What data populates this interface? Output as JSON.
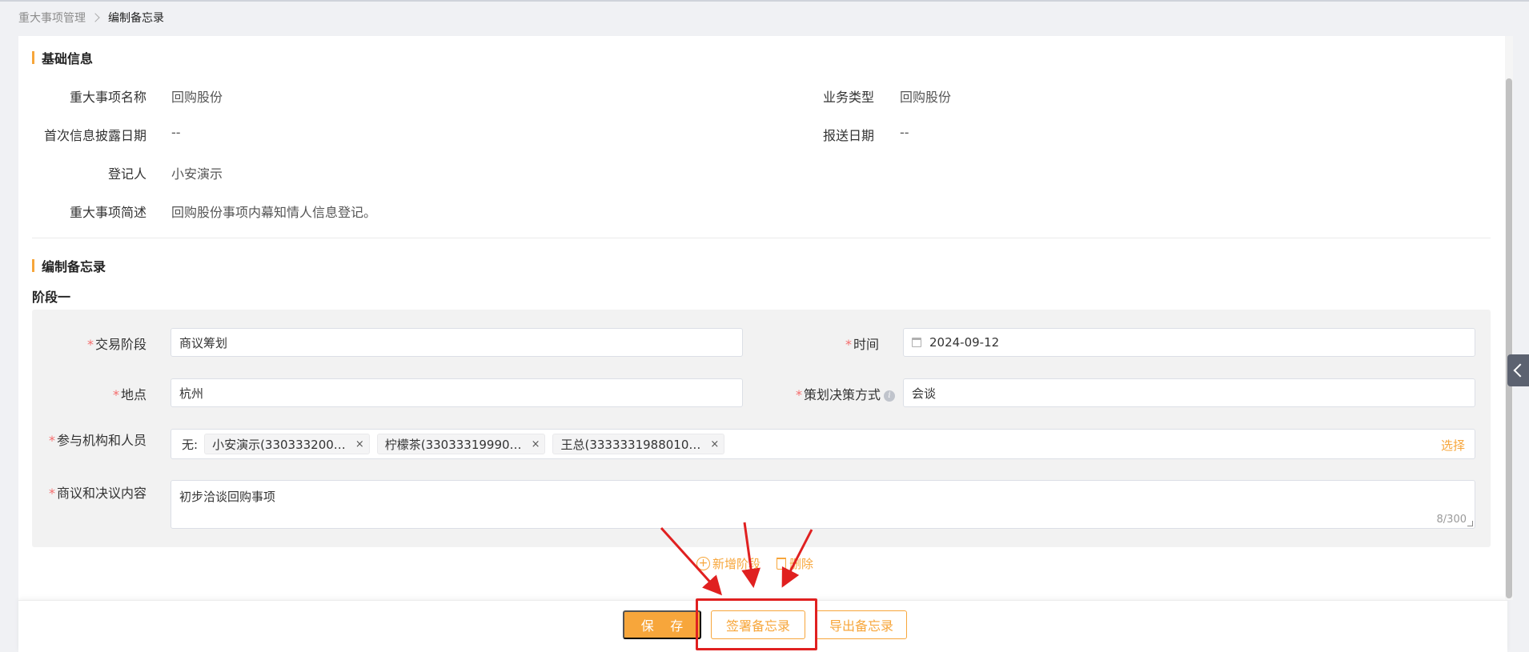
{
  "breadcrumb": {
    "parent": "重大事项管理",
    "current": "编制备忘录"
  },
  "basic_info": {
    "title": "基础信息",
    "fields": {
      "matter_name": {
        "label": "重大事项名称",
        "value": "回购股份"
      },
      "business_type": {
        "label": "业务类型",
        "value": "回购股份"
      },
      "first_disclosure_date": {
        "label": "首次信息披露日期",
        "value": "--"
      },
      "submission_date": {
        "label": "报送日期",
        "value": "--"
      },
      "registrant": {
        "label": "登记人",
        "value": "小安演示"
      },
      "description": {
        "label": "重大事项简述",
        "value": "回购股份事项内幕知情人信息登记。"
      }
    }
  },
  "memo": {
    "title": "编制备忘录",
    "stage_title": "阶段一",
    "required_mark": "*",
    "fields": {
      "trade_stage": {
        "label": "交易阶段",
        "value": "商议筹划"
      },
      "time": {
        "label": "时间",
        "value": "2024-09-12"
      },
      "location": {
        "label": "地点",
        "value": "杭州"
      },
      "decision_method": {
        "label": "策划决策方式",
        "value": "会谈"
      },
      "participants": {
        "label": "参与机构和人员",
        "prefix": "无:",
        "tags": [
          "小安演示(330333200…",
          "柠檬茶(33033319990…",
          "王总(3333331988010…"
        ],
        "tag_close": "×",
        "select_label": "选择"
      },
      "content": {
        "label": "商议和决议内容",
        "value": "初步洽谈回购事项",
        "counter": "8/300"
      }
    },
    "add_stage_label": "新增阶段",
    "delete_label": "删除"
  },
  "footer": {
    "save_label": "保 存",
    "sign_label": "签署备忘录",
    "export_label": "导出备忘录"
  },
  "colors": {
    "accent": "#f7a63b",
    "required": "#f56c6c",
    "annotation": "#e02020"
  }
}
